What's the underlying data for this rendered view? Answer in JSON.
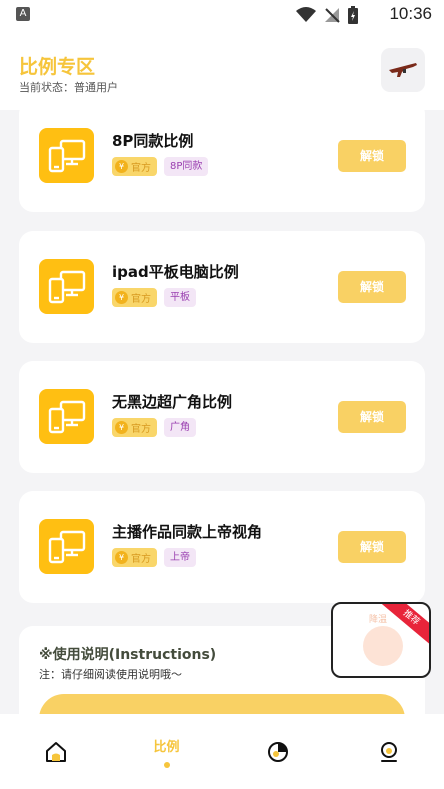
{
  "status_bar": {
    "time": "10:36",
    "left_badge": "A"
  },
  "header": {
    "title": "比例专区",
    "subtitle": "当前状态：普通用户",
    "action_icon": "rifle-icon"
  },
  "cards": [
    {
      "name": "8P同款比例",
      "official_tag": "官方",
      "category_tag": "8P同款",
      "button": "解锁"
    },
    {
      "name": "ipad平板电脑比例",
      "official_tag": "官方",
      "category_tag": "平板",
      "button": "解锁"
    },
    {
      "name": "无黑边超广角比例",
      "official_tag": "官方",
      "category_tag": "广角",
      "button": "解锁"
    },
    {
      "name": "主播作品同款上帝视角",
      "official_tag": "官方",
      "category_tag": "上帝",
      "button": "解锁"
    }
  ],
  "instructions": {
    "title": "※使用说明(Instructions)",
    "note": "注：请仔细阅读使用说明哦～"
  },
  "float_widget": {
    "ribbon": "推荐",
    "label": "降温"
  },
  "bottom_nav": {
    "items": [
      {
        "label": "",
        "icon": "home-icon"
      },
      {
        "label": "比例",
        "icon": "",
        "active": true
      },
      {
        "label": "",
        "icon": "pie-chart-icon"
      },
      {
        "label": "",
        "icon": "user-icon"
      }
    ]
  },
  "colors": {
    "accent": "#f6c53c",
    "tile": "#ffbf12",
    "button": "#f9d164",
    "tag_purple": "#9a3fb0"
  }
}
